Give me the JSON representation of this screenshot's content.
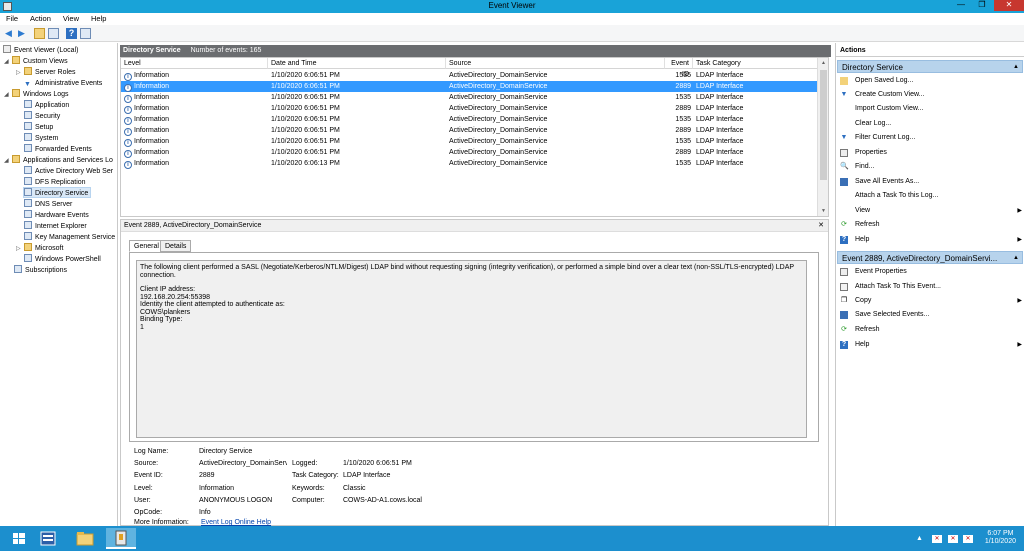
{
  "window": {
    "title": "Event Viewer"
  },
  "colors": {
    "titlebar": "#19a3d8",
    "selection": "#3399ff",
    "pane_header": "#6b6d70",
    "action_section": "#b7d3ec",
    "taskbar": "#1c8fce",
    "link": "#0645ad"
  },
  "menu": [
    "File",
    "Action",
    "View",
    "Help"
  ],
  "toolbar_icons": [
    "back-arrow-icon",
    "forward-arrow-icon",
    "folder-up-icon",
    "console-tree-icon",
    "help-icon",
    "action-pane-icon"
  ],
  "tree": {
    "items": [
      {
        "label": "Event Viewer (Local)",
        "icon": "event-viewer-icon"
      },
      {
        "label": "Custom Views",
        "icon": "folder-icon"
      },
      {
        "label": "Server Roles",
        "icon": "folder-icon"
      },
      {
        "label": "Administrative Events",
        "icon": "filter-icon"
      },
      {
        "label": "Windows Logs",
        "icon": "folder-icon"
      },
      {
        "label": "Application",
        "icon": "log-icon"
      },
      {
        "label": "Security",
        "icon": "log-icon"
      },
      {
        "label": "Setup",
        "icon": "log-icon"
      },
      {
        "label": "System",
        "icon": "log-icon"
      },
      {
        "label": "Forwarded Events",
        "icon": "log-icon"
      },
      {
        "label": "Applications and Services Lo",
        "icon": "folder-icon"
      },
      {
        "label": "Active Directory Web Ser",
        "icon": "log-icon"
      },
      {
        "label": "DFS Replication",
        "icon": "log-icon"
      },
      {
        "label": "Directory Service",
        "icon": "log-icon"
      },
      {
        "label": "DNS Server",
        "icon": "log-icon"
      },
      {
        "label": "Hardware Events",
        "icon": "log-icon"
      },
      {
        "label": "Internet Explorer",
        "icon": "log-icon"
      },
      {
        "label": "Key Management Service",
        "icon": "log-icon"
      },
      {
        "label": "Microsoft",
        "icon": "folder-icon"
      },
      {
        "label": "Windows PowerShell",
        "icon": "log-icon"
      },
      {
        "label": "Subscriptions",
        "icon": "subscriptions-icon"
      }
    ]
  },
  "log": {
    "name": "Directory Service",
    "count_text": "Number of events: 165",
    "columns": [
      "Level",
      "Date and Time",
      "Source",
      "Event ID",
      "Task Category"
    ],
    "rows": [
      [
        "Information",
        "1/10/2020 6:06:51 PM",
        "ActiveDirectory_DomainService",
        "1535",
        "LDAP Interface"
      ],
      [
        "Information",
        "1/10/2020 6:06:51 PM",
        "ActiveDirectory_DomainService",
        "2889",
        "LDAP Interface"
      ],
      [
        "Information",
        "1/10/2020 6:06:51 PM",
        "ActiveDirectory_DomainService",
        "1535",
        "LDAP Interface"
      ],
      [
        "Information",
        "1/10/2020 6:06:51 PM",
        "ActiveDirectory_DomainService",
        "2889",
        "LDAP Interface"
      ],
      [
        "Information",
        "1/10/2020 6:06:51 PM",
        "ActiveDirectory_DomainService",
        "1535",
        "LDAP Interface"
      ],
      [
        "Information",
        "1/10/2020 6:06:51 PM",
        "ActiveDirectory_DomainService",
        "2889",
        "LDAP Interface"
      ],
      [
        "Information",
        "1/10/2020 6:06:51 PM",
        "ActiveDirectory_DomainService",
        "1535",
        "LDAP Interface"
      ],
      [
        "Information",
        "1/10/2020 6:06:51 PM",
        "ActiveDirectory_DomainService",
        "2889",
        "LDAP Interface"
      ],
      [
        "Information",
        "1/10/2020 6:06:13 PM",
        "ActiveDirectory_DomainService",
        "1535",
        "LDAP Interface"
      ]
    ]
  },
  "detail": {
    "header": "Event 2889, ActiveDirectory_DomainService",
    "tabs": [
      "General",
      "Details"
    ],
    "description": {
      "p1": "The following client performed a SASL (Negotiate/Kerberos/NTLM/Digest) LDAP bind without requesting signing (integrity verification), or performed a simple bind over a clear text (non-SSL/TLS-encrypted) LDAP connection.",
      "l1": "Client IP address:",
      "l2": "192.168.20.254:55398",
      "l3": "Identity the client attempted to authenticate as:",
      "l4": "COWS\\plankers",
      "l5": "Binding Type:",
      "l6": "1"
    },
    "props": {
      "log_name_label": "Log Name:",
      "log_name": "Directory Service",
      "source_label": "Source:",
      "source": "ActiveDirectory_DomainServ",
      "logged_label": "Logged:",
      "logged": "1/10/2020 6:06:51 PM",
      "event_id_label": "Event ID:",
      "event_id": "2889",
      "task_category_label": "Task Category:",
      "task_category": "LDAP Interface",
      "level_label": "Level:",
      "level": "Information",
      "keywords_label": "Keywords:",
      "keywords": "Classic",
      "user_label": "User:",
      "user": "ANONYMOUS LOGON",
      "computer_label": "Computer:",
      "computer": "COWS-AD-A1.cows.local",
      "opcode_label": "OpCode:",
      "opcode": "Info",
      "more_info_label": "More Information:",
      "more_info_link": "Event Log Online Help"
    }
  },
  "actions": {
    "title": "Actions",
    "section1": {
      "title": "Directory Service",
      "items": [
        {
          "label": "Open Saved Log...",
          "icon": "open-folder-icon"
        },
        {
          "label": "Create Custom View...",
          "icon": "create-view-icon"
        },
        {
          "label": "Import Custom View...",
          "icon": ""
        },
        {
          "label": "Clear Log...",
          "icon": ""
        },
        {
          "label": "Filter Current Log...",
          "icon": "filter-icon"
        },
        {
          "label": "Properties",
          "icon": "properties-icon"
        },
        {
          "label": "Find...",
          "icon": "find-icon"
        },
        {
          "label": "Save All Events As...",
          "icon": "save-icon"
        },
        {
          "label": "Attach a Task To this Log...",
          "icon": ""
        },
        {
          "label": "View",
          "icon": "",
          "submenu": true
        },
        {
          "label": "Refresh",
          "icon": "refresh-icon"
        },
        {
          "label": "Help",
          "icon": "help-icon",
          "submenu": true
        }
      ]
    },
    "section2": {
      "title": "Event 2889, ActiveDirectory_DomainServi...",
      "items": [
        {
          "label": "Event Properties",
          "icon": "event-properties-icon"
        },
        {
          "label": "Attach Task To This Event...",
          "icon": "task-icon"
        },
        {
          "label": "Copy",
          "icon": "copy-icon",
          "submenu": true
        },
        {
          "label": "Save Selected Events...",
          "icon": "save-icon"
        },
        {
          "label": "Refresh",
          "icon": "refresh-icon"
        },
        {
          "label": "Help",
          "icon": "help-icon",
          "submenu": true
        }
      ]
    }
  },
  "taskbar": {
    "items": [
      "start-icon",
      "server-manager-icon",
      "file-explorer-icon",
      "event-viewer-icon"
    ],
    "time": "6:07 PM",
    "date": "1/10/2020"
  }
}
